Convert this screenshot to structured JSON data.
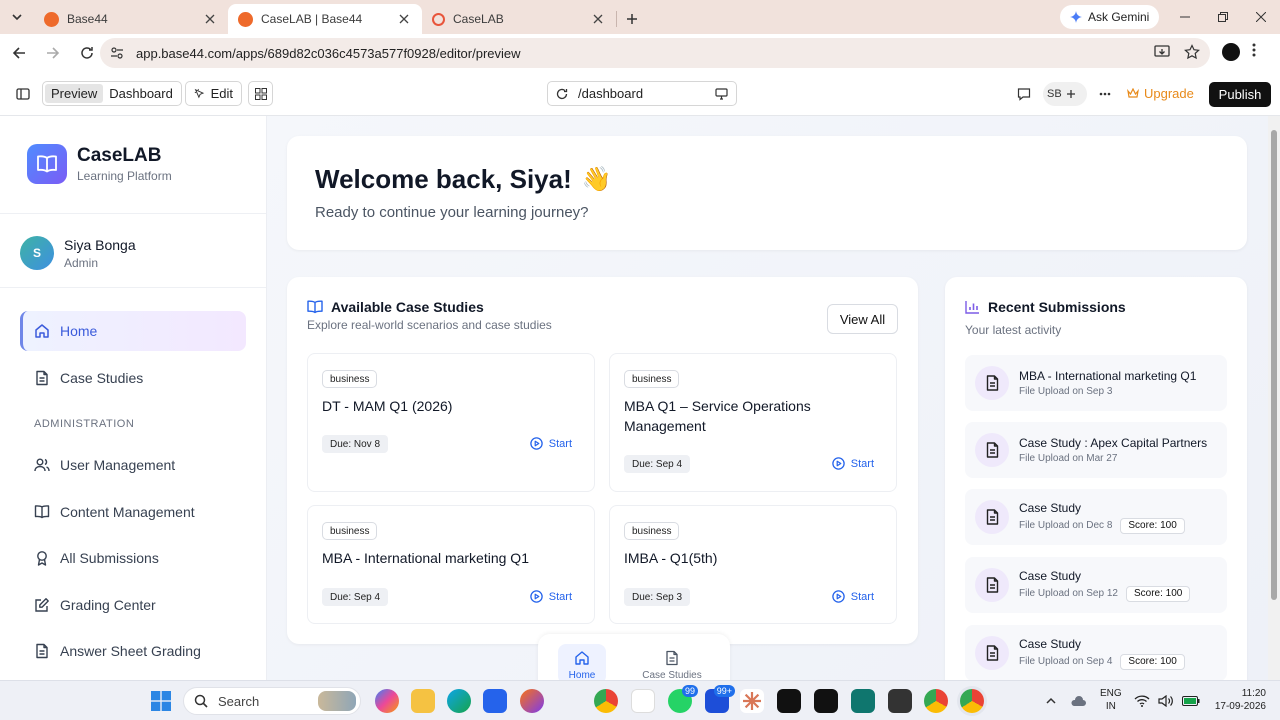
{
  "browser": {
    "tabs": [
      {
        "title": "Base44",
        "active": false
      },
      {
        "title": "CaseLAB | Base44",
        "active": true
      },
      {
        "title": "CaseLAB",
        "active": false
      }
    ],
    "gemini_label": "Ask Gemini",
    "url": "app.base44.com/apps/689d82c036c4573a577f0928/editor/preview"
  },
  "toolbar": {
    "preview_label": "Preview",
    "dashboard_label": "Dashboard",
    "edit_label": "Edit",
    "route": "/dashboard",
    "user_initials": "SB",
    "upgrade_label": "Upgrade",
    "publish_label": "Publish"
  },
  "sidebar": {
    "brand_name": "CaseLAB",
    "brand_sub": "Learning Platform",
    "user": {
      "initial": "S",
      "name": "Siya Bonga",
      "role": "Admin"
    },
    "items": [
      {
        "label": "Home",
        "icon": "home-icon",
        "active": true
      },
      {
        "label": "Case Studies",
        "icon": "document-icon",
        "active": false
      }
    ],
    "section_label": "ADMINISTRATION",
    "admin_items": [
      {
        "label": "User Management",
        "icon": "users-icon"
      },
      {
        "label": "Content Management",
        "icon": "book-icon"
      },
      {
        "label": "All Submissions",
        "icon": "award-icon"
      },
      {
        "label": "Grading Center",
        "icon": "edit-icon"
      },
      {
        "label": "Answer Sheet Grading",
        "icon": "document-icon"
      }
    ]
  },
  "welcome": {
    "title": "Welcome back, Siya!",
    "emoji": "👋",
    "subtitle": "Ready to continue your learning journey?"
  },
  "case_studies": {
    "title": "Available Case Studies",
    "subtitle": "Explore real-world scenarios and case studies",
    "view_all": "View All",
    "start_label": "Start",
    "items": [
      {
        "tag": "business",
        "title": "DT - MAM Q1 (2026)",
        "due": "Due: Nov 8"
      },
      {
        "tag": "business",
        "title": "MBA Q1 – Service Operations Management",
        "due": "Due: Sep 4"
      },
      {
        "tag": "business",
        "title": "MBA - International marketing Q1",
        "due": "Due: Sep 4"
      },
      {
        "tag": "business",
        "title": "IMBA - Q1(5th)",
        "due": "Due: Sep 3"
      }
    ]
  },
  "submissions": {
    "title": "Recent Submissions",
    "subtitle": "Your latest activity",
    "items": [
      {
        "title": "MBA - International marketing Q1",
        "meta": "File Upload on Sep 3",
        "score": ""
      },
      {
        "title": "Case Study : Apex Capital Partners",
        "meta": "File Upload on Mar 27",
        "score": ""
      },
      {
        "title": "Case Study",
        "meta": "File Upload on Dec 8",
        "score": "Score: 100"
      },
      {
        "title": "Case Study",
        "meta": "File Upload on Sep 12",
        "score": "Score: 100"
      },
      {
        "title": "Case Study",
        "meta": "File Upload on Sep 4",
        "score": "Score: 100"
      }
    ]
  },
  "bottom_nav": [
    {
      "label": "Home",
      "active": true
    },
    {
      "label": "Case Studies",
      "active": false
    }
  ],
  "taskbar": {
    "search_placeholder": "Search",
    "whatsapp_badge": "99",
    "mail_badge": "99+",
    "lang_line1": "ENG",
    "lang_line2": "IN",
    "time": "11:20",
    "date": "17-09-2026"
  },
  "colors": {
    "accent": "#2563eb",
    "upgrade": "#e88a1a",
    "publish_bg": "#111111",
    "brand_gradient_start": "#4f8cff",
    "brand_gradient_end": "#7b5cf5"
  }
}
